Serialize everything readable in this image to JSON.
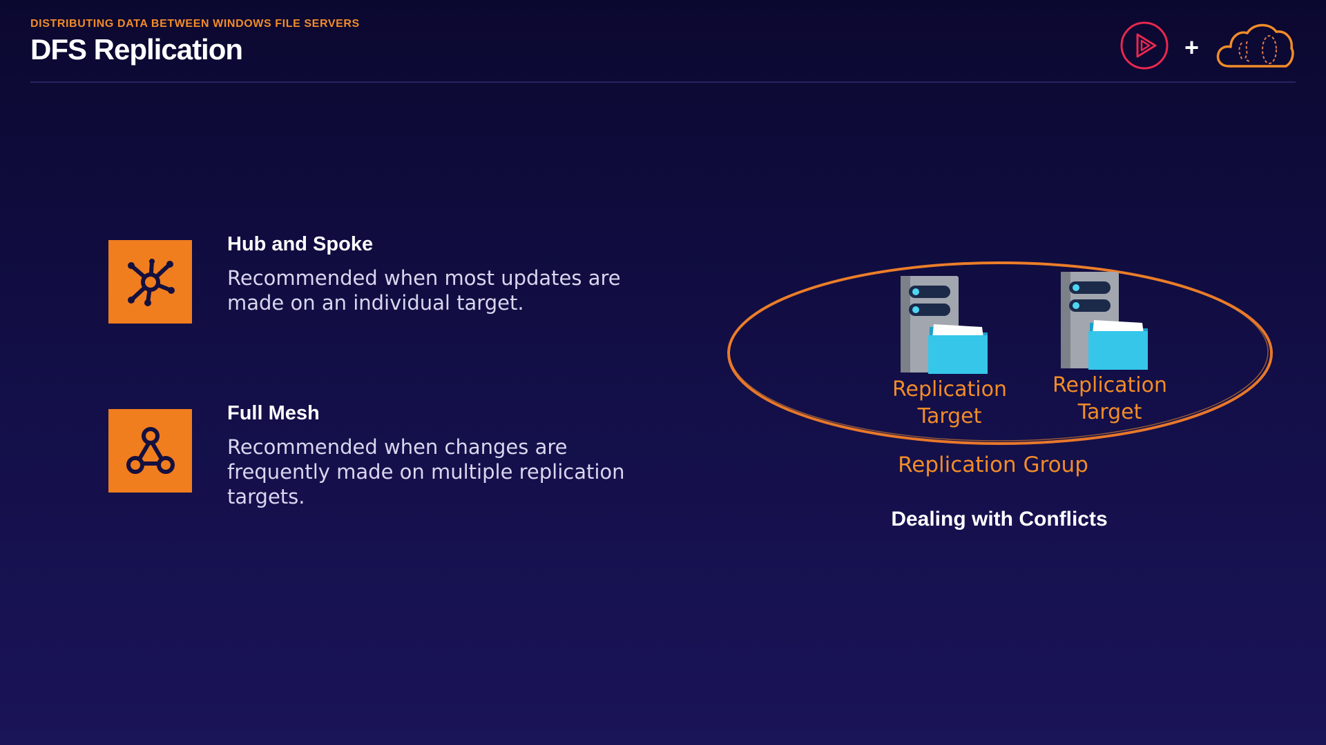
{
  "header": {
    "eyebrow": "DISTRIBUTING DATA BETWEEN WINDOWS FILE SERVERS",
    "title": "DFS Replication",
    "plus": "+"
  },
  "features": [
    {
      "icon": "hub-spoke-icon",
      "title": "Hub and Spoke",
      "description": "Recommended when most updates are made on an individual target."
    },
    {
      "icon": "full-mesh-icon",
      "title": "Full Mesh",
      "description": "Recommended when changes are frequently made on multiple replication targets."
    }
  ],
  "diagram": {
    "targets": [
      {
        "label": "Replication Target"
      },
      {
        "label": "Replication Target"
      }
    ],
    "group_label": "Replication Group"
  },
  "conflicts_label": "Dealing with Conflicts",
  "colors": {
    "accent": "#f07d1e",
    "label_orange": "#f28c28",
    "folder": "#2ec4e8",
    "server": "#9a9ea6",
    "background_top": "#0b0830",
    "background_bottom": "#1a1458",
    "pluralsight_red": "#e8284f"
  }
}
